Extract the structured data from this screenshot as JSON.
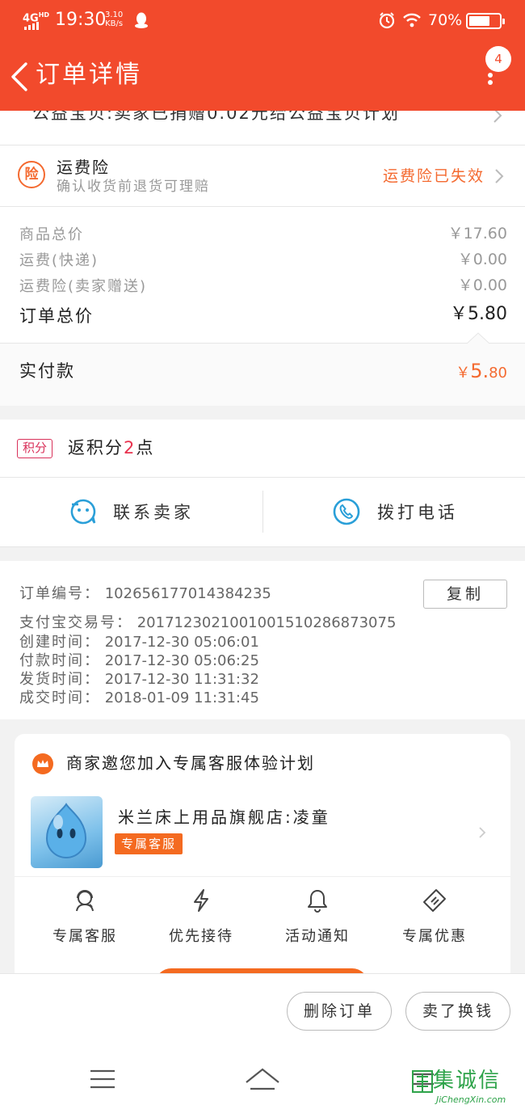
{
  "status_bar": {
    "network": "4G",
    "network_hd": "HD",
    "time": "19:30",
    "speed_value": "3.10",
    "speed_unit": "KB/s",
    "battery": "70%",
    "battery_level": 0.7
  },
  "header": {
    "title": "订单详情",
    "badge_count": "4"
  },
  "charity": {
    "text": "公益宝贝:卖家已捐赠0.02元给公益宝贝计划"
  },
  "insurance": {
    "icon_char": "险",
    "title": "运费险",
    "subtitle": "确认收货前退货可理赔",
    "status": "运费险已失效"
  },
  "prices": {
    "rows": [
      {
        "label": "商品总价",
        "value": "￥17.60"
      },
      {
        "label": "运费(快递)",
        "value": "￥0.00"
      },
      {
        "label": "运费险(卖家赠送)",
        "value": "￥0.00"
      }
    ],
    "total_label": "订单总价",
    "total_value": "￥5.80",
    "paid_label": "实付款",
    "paid_symbol": "￥",
    "paid_int": "5.",
    "paid_dec": "80"
  },
  "points": {
    "tag": "积分",
    "prefix": "返积分",
    "num": "2",
    "suffix": "点"
  },
  "contact": {
    "seller_label": "联系卖家",
    "phone_label": "拨打电话"
  },
  "order_info": {
    "order_no_label": "订单编号：",
    "order_no": "102656177014384235",
    "copy_label": "复制",
    "rows": [
      {
        "label": "支付宝交易号：",
        "value": "2017123021001001510286873075"
      },
      {
        "label": "创建时间：",
        "value": "2017-12-30 05:06:01"
      },
      {
        "label": "付款时间：",
        "value": "2017-12-30 05:06:25"
      },
      {
        "label": "发货时间：",
        "value": "2017-12-30 11:31:32"
      },
      {
        "label": "成交时间：",
        "value": "2018-01-09 11:31:45"
      }
    ]
  },
  "promo": {
    "title": "商家邀您加入专属客服体验计划",
    "shop_name": "米兰床上用品旗舰店:凌童",
    "badge": "专属客服",
    "features": [
      {
        "label": "专属客服",
        "icon": "headset-icon"
      },
      {
        "label": "优先接待",
        "icon": "lightning-icon"
      },
      {
        "label": "活动通知",
        "icon": "bell-icon"
      },
      {
        "label": "专属优惠",
        "icon": "coupon-icon"
      }
    ]
  },
  "actions": {
    "delete_label": "删除订单",
    "resell_label": "卖了换钱"
  },
  "watermark": {
    "logo": "集诚信",
    "text": "JiChengXin.com"
  },
  "colors": {
    "brand": "#f24a2c",
    "accent_orange": "#f46a30",
    "points_pink": "#d9315a",
    "contact_blue": "#2a9fd8"
  }
}
